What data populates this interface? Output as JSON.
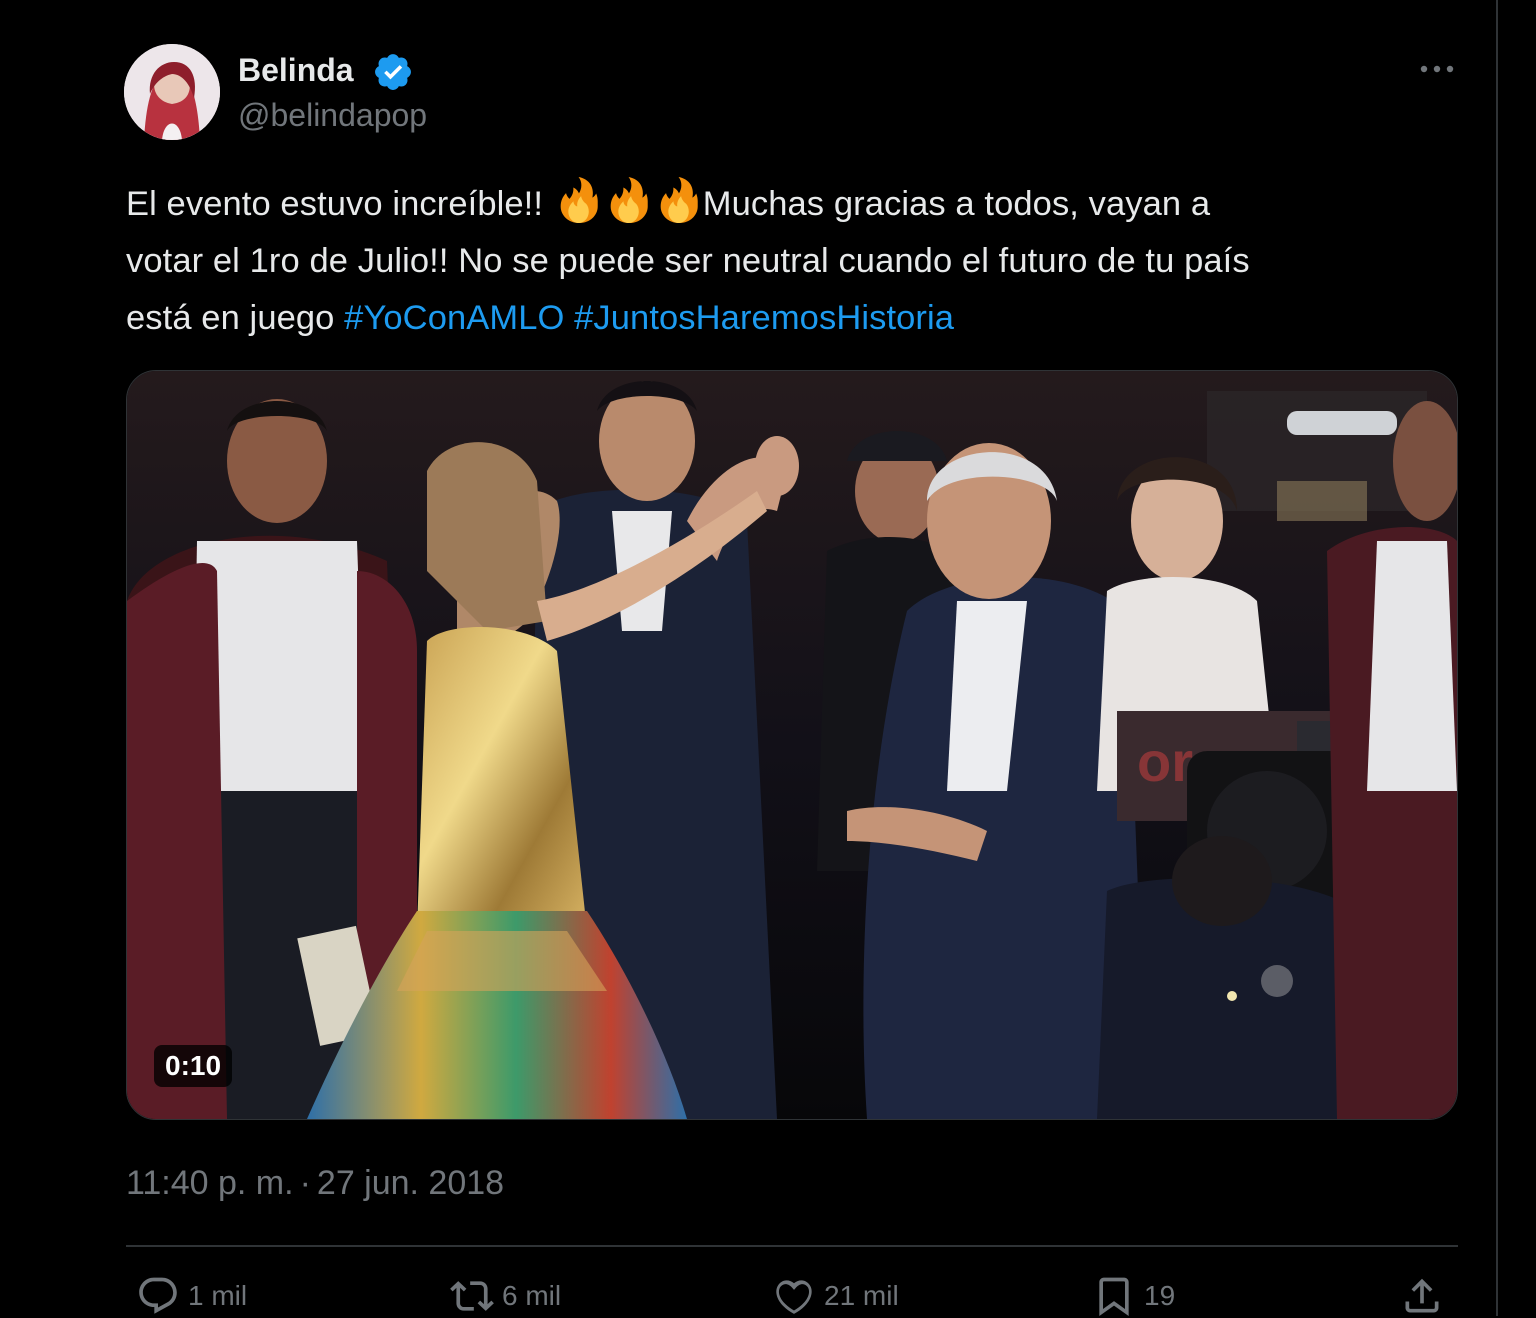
{
  "tweet": {
    "author": {
      "display_name": "Belinda",
      "handle": "@belindapop",
      "verified_icon": "verified-badge-icon",
      "avatar_icon": "avatar"
    },
    "more_icon": "more-options-icon",
    "text": {
      "line1_before": "El evento estuvo increíble!!",
      "line1_after": "Muchas gracias a todos, vayan a",
      "line2": "votar el 1ro de Julio!! No se puede ser neutral cuando el futuro de tu país",
      "line3_before": "está en juego",
      "hashtag1": "#YoConAMLO",
      "hashtag2": "#JuntosHaremosHistoria",
      "emoji": "fire-emoji-icon",
      "emoji_count": 3
    },
    "media": {
      "type": "video",
      "duration": "0:10"
    },
    "timestamp": {
      "time": "11:40 p. m.",
      "separator": "·",
      "date": "27 jun. 2018"
    },
    "actions": {
      "replies": "1 mil",
      "reposts": "6 mil",
      "likes": "21 mil",
      "bookmarks": "19"
    }
  },
  "colors": {
    "background": "#000000",
    "text_primary": "#e7e9ea",
    "text_secondary": "#71767b",
    "link": "#1d9bf0",
    "verified": "#1d9bf0",
    "border": "#2f3336"
  }
}
